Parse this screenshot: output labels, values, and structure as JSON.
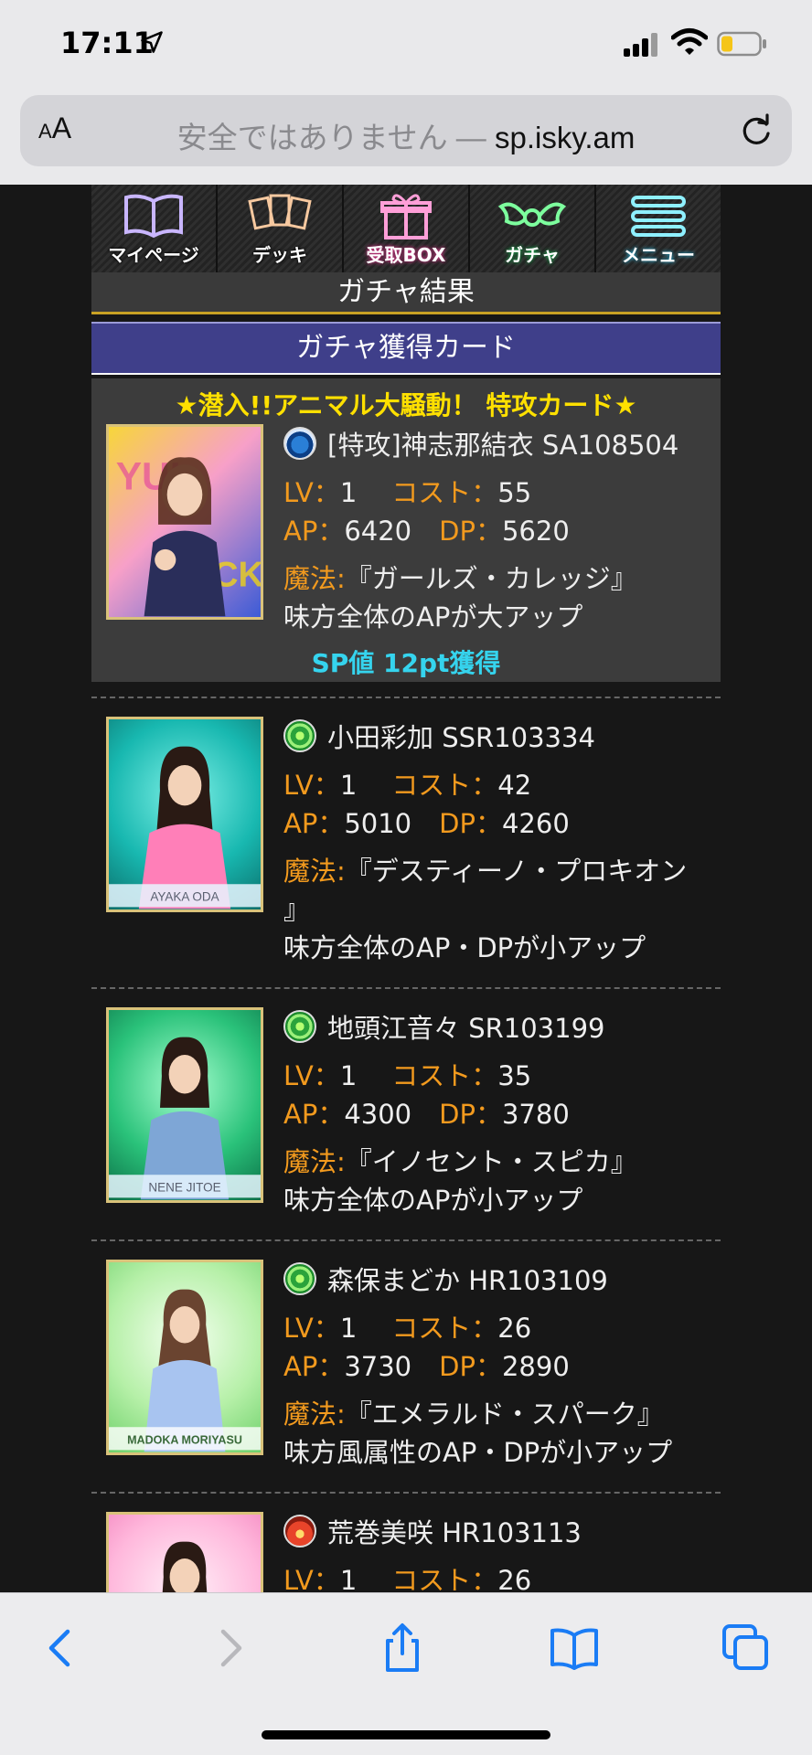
{
  "status_bar": {
    "time": "17:11"
  },
  "browser": {
    "aa_label": "AA",
    "insecure_text": "安全ではありません —",
    "host": "sp.isky.am"
  },
  "nav": {
    "items": [
      {
        "label": "マイページ",
        "icon": "book-icon"
      },
      {
        "label": "デッキ",
        "icon": "cards-icon"
      },
      {
        "label": "受取BOX",
        "icon": "gift-icon"
      },
      {
        "label": "ガチャ",
        "icon": "wings-icon"
      },
      {
        "label": "メニュー",
        "icon": "menu-icon"
      }
    ]
  },
  "page_title": "ガチャ結果",
  "section_title": "ガチャ獲得カード",
  "featured_title": "★潜入!!アニマル大騒動！ 特攻カード★",
  "sp_gain": "SP値 12pt獲得",
  "labels": {
    "lv": "LV：",
    "cost": "コスト：",
    "ap": "AP：",
    "dp": "DP：",
    "magic": "魔法:"
  },
  "cards": [
    {
      "attribute": "water",
      "name": "[特攻]神志那結衣 SA108504",
      "lv": "1",
      "cost": "55",
      "ap": "6420",
      "dp": "5620",
      "magic": "『ガールズ・カレッジ』",
      "magic_cont": "",
      "effect": "味方全体のAPが大アップ",
      "rarity_badge": "SA",
      "nameplate": ""
    },
    {
      "attribute": "wind",
      "name": "小田彩加 SSR103334",
      "lv": "1",
      "cost": "42",
      "ap": "5010",
      "dp": "4260",
      "magic": "『デスティーノ・プロキオン",
      "magic_cont": "』",
      "effect": "味方全体のAP・DPが小アップ",
      "rarity_badge": "SSR",
      "nameplate": "AYAKA ODA"
    },
    {
      "attribute": "wind",
      "name": "地頭江音々 SR103199",
      "lv": "1",
      "cost": "35",
      "ap": "4300",
      "dp": "3780",
      "magic": "『イノセント・スピカ』",
      "magic_cont": "",
      "effect": "味方全体のAPが小アップ",
      "rarity_badge": "SR",
      "nameplate": "NENE JITOE"
    },
    {
      "attribute": "wind",
      "name": "森保まどか HR103109",
      "lv": "1",
      "cost": "26",
      "ap": "3730",
      "dp": "2890",
      "magic": "『エメラルド・スパーク』",
      "magic_cont": "",
      "effect": "味方風属性のAP・DPが小アップ",
      "rarity_badge": "HR",
      "nameplate": "MADOKA MORIYASU"
    },
    {
      "attribute": "fire",
      "name": "荒巻美咲 HR103113",
      "lv": "1",
      "cost": "26",
      "rarity_badge": "HR"
    }
  ],
  "toolbar": [
    "back-icon",
    "forward-icon",
    "share-icon",
    "bookmarks-icon",
    "tabs-icon"
  ],
  "colors": {
    "label_orange": "#f29a1e",
    "featured_yellow": "#ffe000",
    "sp_cyan": "#35d4ee",
    "section_blue": "#3f3f8a"
  }
}
